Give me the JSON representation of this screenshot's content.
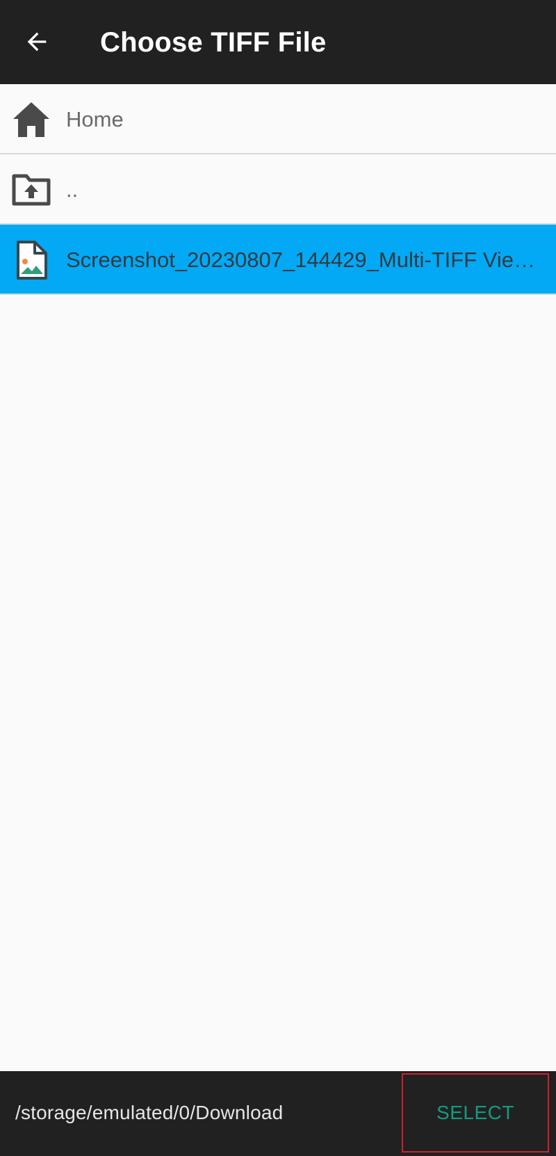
{
  "app_bar": {
    "title": "Choose TIFF File",
    "back_icon": "arrow-left-icon"
  },
  "list": {
    "items": [
      {
        "label": "Home",
        "icon": "home-icon",
        "selected": false
      },
      {
        "label": "..",
        "icon": "folder-up-icon",
        "selected": false
      },
      {
        "label": "Screenshot_20230807_144429_Multi-TIFF Vie…",
        "icon": "image-file-icon",
        "selected": true
      }
    ]
  },
  "bottom_bar": {
    "path": "/storage/emulated/0/Download",
    "select_label": "SELECT"
  },
  "colors": {
    "app_bar_bg": "#212121",
    "selected_row_bg": "#03a9f4",
    "select_text": "#129c84",
    "highlight_border": "#d0212b"
  }
}
